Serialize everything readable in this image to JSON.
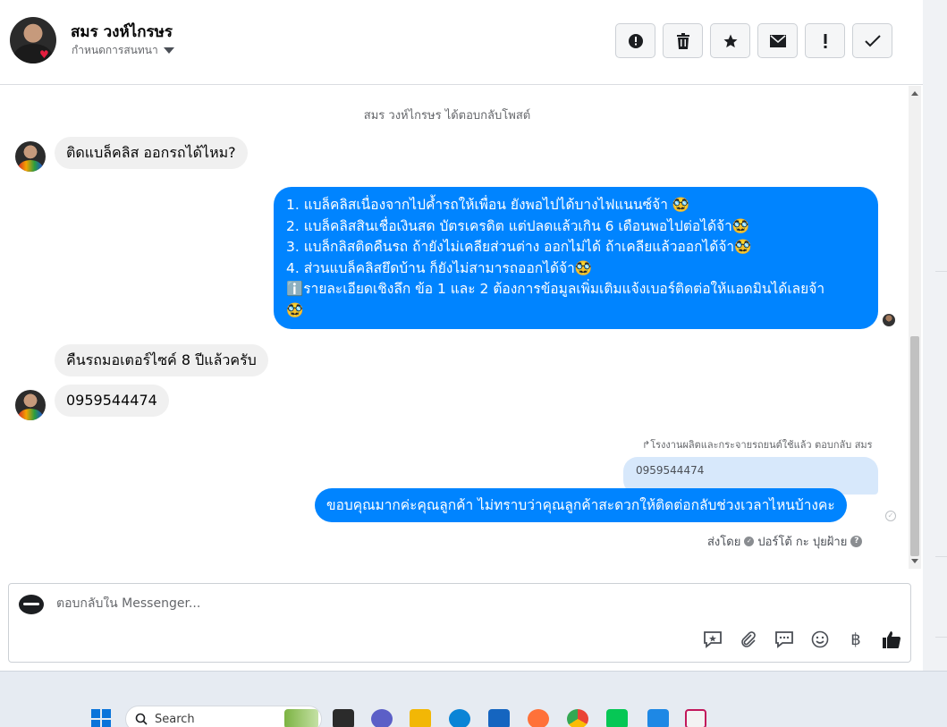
{
  "header": {
    "contact_name": "สมร วงห์ไกรษร",
    "assign_label": "กำหนดการสนทนา",
    "tools": [
      {
        "name": "report-spam-button",
        "icon": "alert-circle-icon",
        "glyph": "!"
      },
      {
        "name": "delete-button",
        "icon": "trash-icon",
        "glyph": "🗑"
      },
      {
        "name": "star-button",
        "icon": "star-icon",
        "glyph": "★"
      },
      {
        "name": "mark-unread-button",
        "icon": "envelope-icon",
        "glyph": "✉"
      },
      {
        "name": "follow-up-button",
        "icon": "exclamation-icon",
        "glyph": "!"
      },
      {
        "name": "mark-done-button",
        "icon": "check-icon",
        "glyph": "✓"
      }
    ]
  },
  "messages": {
    "system_note": "สมร วงห์ไกรษร ได้ตอบกลับโพสต์",
    "in_1": "ติดแบล็คลิส ออกรถได้ไหม?",
    "out_1": [
      "1. แบล็คลิสเนื่องจากไปค้ำรถให้เพื่อน ยังพอไปได้บางไฟแนนซ์จ้า 🥸",
      "2. แบล็คลิสสินเชื่อเงินสด บัตรเครดิต แต่ปลดแล้วเกิน 6 เดือนพอไปต่อได้จ้า🥸",
      "3. แบล็กลิสติดคืนรถ ถ้ายังไม่เคลียส่วนต่าง ออกไม่ได้ ถ้าเคลียแล้วออกได้จ้า🥸",
      "4. ส่วนแบล็คลิสยึดบ้าน ก็ยังไม่สามารถออกได้จ้า🥸",
      "ℹ️รายละเอียดเชิงลึก ข้อ 1 และ 2 ต้องการข้อมูลเพิ่มเติมแจ้งเบอร์ติดต่อให้แอดมินได้เลยจ้า",
      "🥸"
    ],
    "in_2": "คืนรถมอเตอร์ไซค์ 8 ปีแล้วครับ",
    "in_3": "0959544474",
    "reply_label": "↱โรงงานผลิตและกระจายรถยนต์ใช้แล้ว ตอบกลับ สมร",
    "quoted_text": "0959544474",
    "out_2": "ขอบคุณมากค่ะคุณลูกค้า ไม่ทราบว่าคุณลูกค้าสะดวกให้ติดต่อกลับช่วงเวลาไหนบ้างคะ",
    "sent_by_prefix": "ส่งโดย",
    "sent_by_name": "ปอร์โต้ กะ ปุยฝ้าย"
  },
  "composer": {
    "placeholder": "ตอบกลับใน Messenger...",
    "tools": [
      {
        "name": "saved-replies-icon",
        "glyph": "💬"
      },
      {
        "name": "attach-icon",
        "glyph": "📎"
      },
      {
        "name": "chat-bubble-icon",
        "glyph": "🗨"
      },
      {
        "name": "emoji-icon",
        "glyph": "☺"
      },
      {
        "name": "payment-icon",
        "glyph": "฿"
      },
      {
        "name": "like-icon",
        "glyph": "👍"
      }
    ]
  },
  "taskbar": {
    "search_placeholder": "Search"
  },
  "colors": {
    "outgoing_bubble": "#0084ff",
    "incoming_bubble": "#f0f0f0",
    "quoted_bubble": "#d7e8fb"
  }
}
